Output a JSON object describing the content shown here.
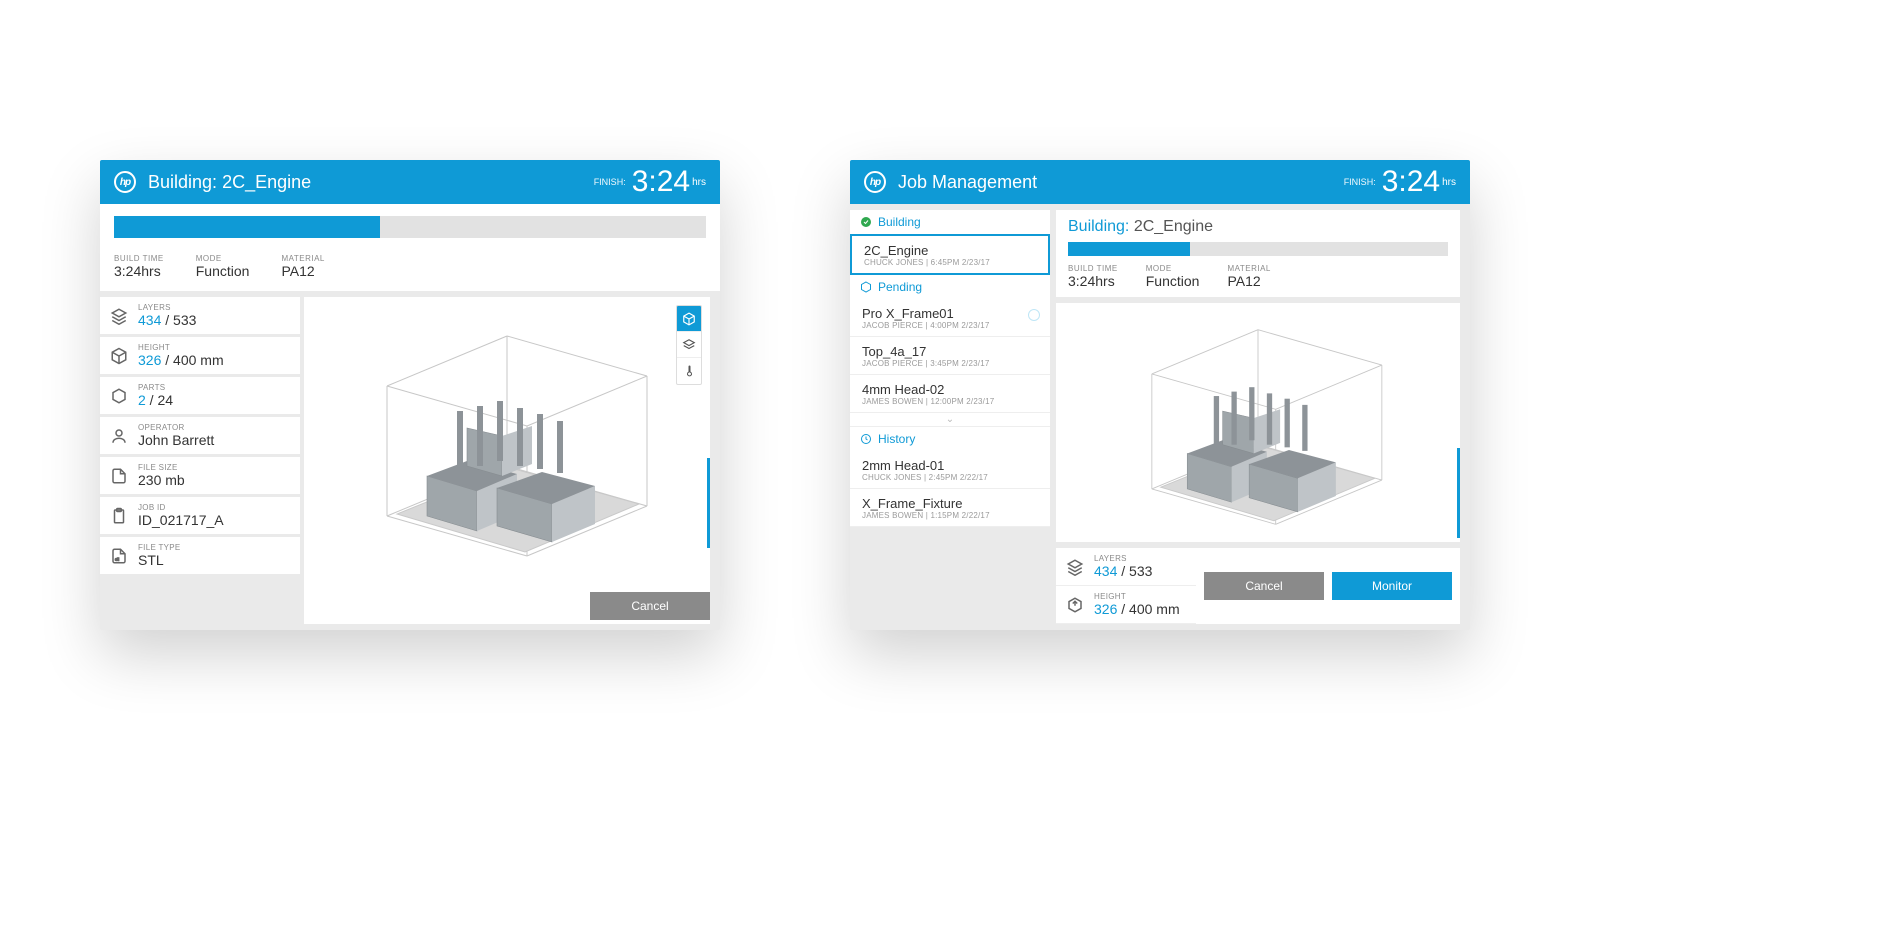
{
  "left": {
    "header": {
      "title_prefix": "Building:",
      "title_job": "2C_Engine",
      "finish_label": "FINISH:",
      "finish_value": "3:24",
      "finish_unit": "hrs"
    },
    "progress_pct": 45,
    "summary": {
      "build_time_label": "BUILD TIME",
      "build_time_value": "3:24hrs",
      "mode_label": "MODE",
      "mode_value": "Function",
      "material_label": "MATERIAL",
      "material_value": "PA12"
    },
    "stats": {
      "layers_label": "LAYERS",
      "layers_done": "434",
      "layers_total": " / 533",
      "height_label": "HEIGHT",
      "height_done": "326",
      "height_total": " / 400 mm",
      "parts_label": "PARTS",
      "parts_done": "2",
      "parts_total": " / 24",
      "operator_label": "OPERATOR",
      "operator_value": "John Barrett",
      "filesize_label": "FILE SIZE",
      "filesize_value": "230 mb",
      "jobid_label": "JOB ID",
      "jobid_value": "ID_021717_A",
      "filetype_label": "FILE TYPE",
      "filetype_value": "STL"
    },
    "buttons": {
      "cancel": "Cancel"
    }
  },
  "right": {
    "header": {
      "title": "Job Management",
      "finish_label": "FINISH:",
      "finish_value": "3:24",
      "finish_unit": "hrs"
    },
    "sections": {
      "building": "Building",
      "pending": "Pending",
      "history": "History"
    },
    "jobs": {
      "building": {
        "name": "2C_Engine",
        "meta": "CHUCK JONES | 6:45PM 2/23/17"
      },
      "pending": [
        {
          "name": "Pro X_Frame01",
          "meta": "JACOB PIERCE | 4:00PM 2/23/17"
        },
        {
          "name": "Top_4a_17",
          "meta": "JACOB PIERCE | 3:45PM 2/23/17"
        },
        {
          "name": "4mm Head-02",
          "meta": "JAMES BOWEN | 12:00PM 2/23/17"
        }
      ],
      "history": [
        {
          "name": "2mm Head-01",
          "meta": "CHUCK JONES | 2:45PM 2/22/17"
        },
        {
          "name": "X_Frame_Fixture",
          "meta": "JAMES BOWEN | 1:15PM 2/22/17"
        }
      ]
    },
    "detail": {
      "title_prefix": "Building:",
      "title_job": "2C_Engine",
      "progress_pct": 32,
      "summary": {
        "build_time_label": "BUILD TIME",
        "build_time_value": "3:24hrs",
        "mode_label": "MODE",
        "mode_value": "Function",
        "material_label": "MATERIAL",
        "material_value": "PA12"
      },
      "stats": {
        "layers_label": "LAYERS",
        "layers_done": "434",
        "layers_total": " / 533",
        "height_label": "HEIGHT",
        "height_done": "326",
        "height_total": " / 400 mm"
      },
      "buttons": {
        "cancel": "Cancel",
        "monitor": "Monitor"
      }
    }
  }
}
